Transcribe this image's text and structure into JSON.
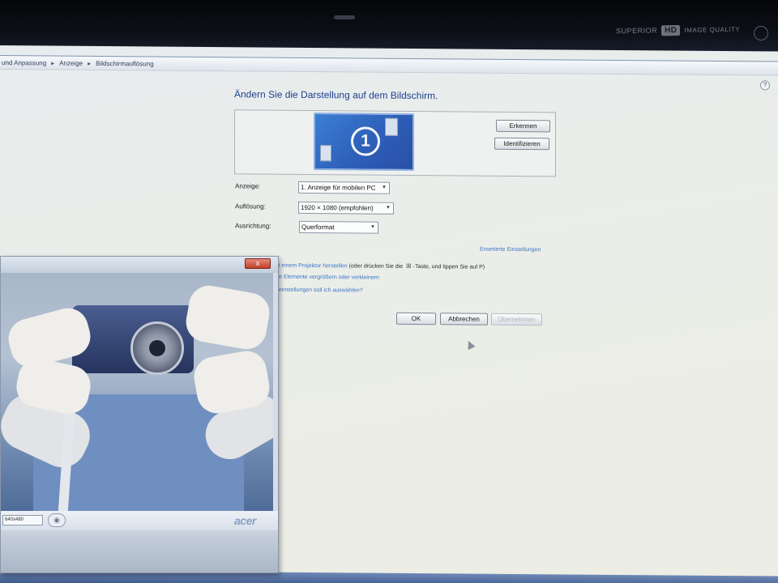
{
  "monitor": {
    "brand_prefix": "SUPERIOR",
    "brand_hd": "HD",
    "brand_suffix": "IMAGE QUALITY"
  },
  "breadcrumb": [
    "und Anpassung",
    "Anzeige",
    "Bildschirmauflösung"
  ],
  "display_settings": {
    "heading": "Ändern Sie die Darstellung auf dem Bildschirm.",
    "monitor_number": "1",
    "buttons": {
      "detect": "Erkennen",
      "identify": "Identifizieren"
    },
    "fields": {
      "display_label": "Anzeige:",
      "display_value": "1. Anzeige für mobilen PC",
      "resolution_label": "Auflösung:",
      "resolution_value": "1920 × 1080 (empfohlen)",
      "orientation_label": "Ausrichtung:",
      "orientation_value": "Querformat"
    },
    "advanced_link": "Erweiterte Einstellungen",
    "links": {
      "projector": "mit einem Projektor herstellen",
      "projector_suffix_1": "(oder drücken Sie die",
      "projector_suffix_2": "-Taste, und tippen Sie auf P)",
      "text_size": "tere Elemente vergrößern oder verkleinern",
      "which_settings": "geeinstellungen soll ich auswählen?"
    },
    "footer_buttons": {
      "ok": "OK",
      "cancel": "Abbrechen",
      "apply": "Übernehmen"
    }
  },
  "webcam_window": {
    "close_label": "x",
    "resolution_select": "640x480",
    "brand": "acer"
  },
  "colors": {
    "heading": "#1e3f91",
    "link": "#3c74c6",
    "monitor_preview": "#2e5fb8"
  }
}
